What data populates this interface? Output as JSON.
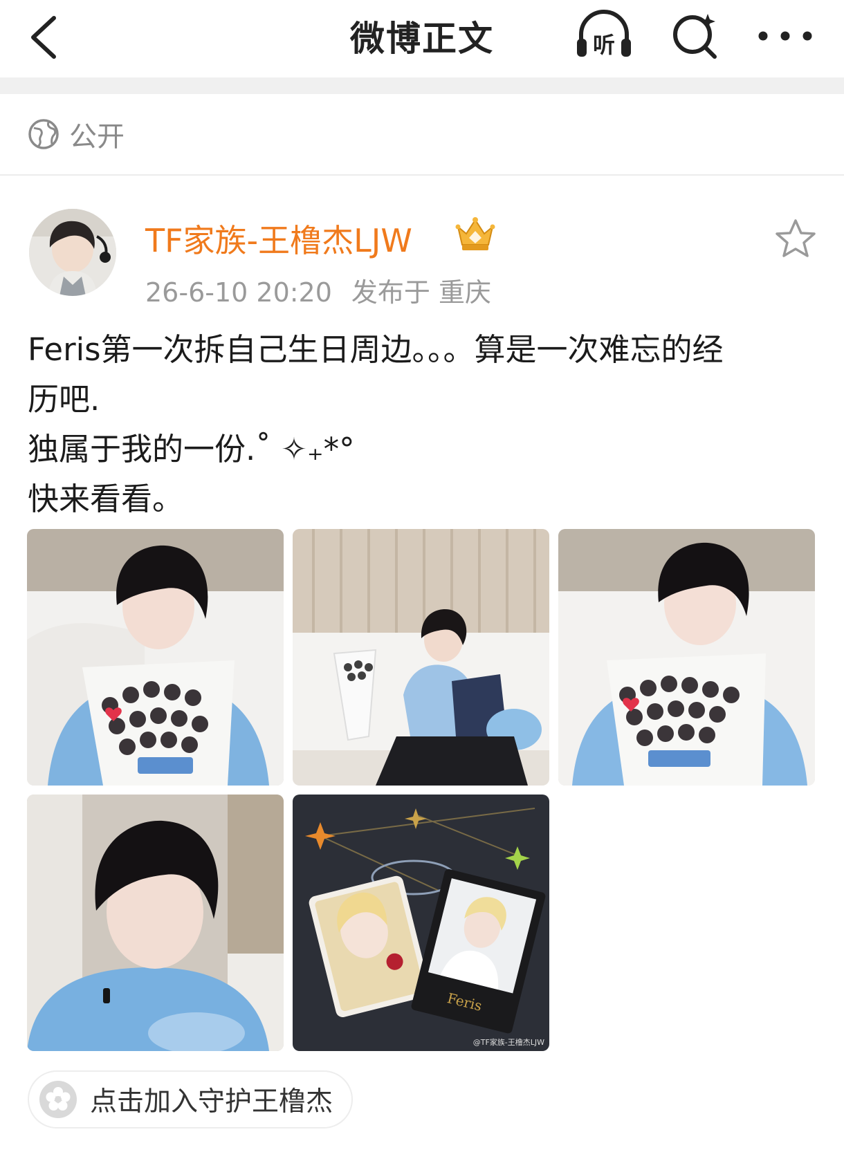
{
  "header": {
    "title": "微博正文",
    "back_icon": "chevron-left-icon",
    "listen_icon": "headphones-icon",
    "listen_label": "听",
    "search_icon": "ai-search-icon",
    "more_icon": "more-dots-icon"
  },
  "visibility": {
    "icon": "globe-icon",
    "label": "公开"
  },
  "post": {
    "author": "TF家族-王橹杰LJW",
    "badge_icon": "crown-badge-icon",
    "timestamp": "26-6-10 20:20",
    "location": "发布于 重庆",
    "favorite_icon": "star-outline-icon",
    "text_lines": [
      "Feris第一次拆自己生日周边。。。算是一次难忘的经",
      "历吧.",
      "独属于我的一份.˚ ✧₊*°",
      "快来看看。"
    ],
    "photos": [
      "photo-boy-holding-photo-bouquet",
      "photo-boy-on-sofa-with-bouquet",
      "photo-boy-holding-photo-bouquet-2",
      "photo-boy-closeup-blue-hoodie",
      "photo-feris-photocards"
    ],
    "watermark": "@TF家族-王橹杰LJW"
  },
  "join": {
    "icon": "flower-icon",
    "label": "点击加入守护王橹杰"
  },
  "colors": {
    "username": "#f07a1c",
    "meta_gray": "#9a9a9a",
    "divider": "#f0f0f0"
  }
}
